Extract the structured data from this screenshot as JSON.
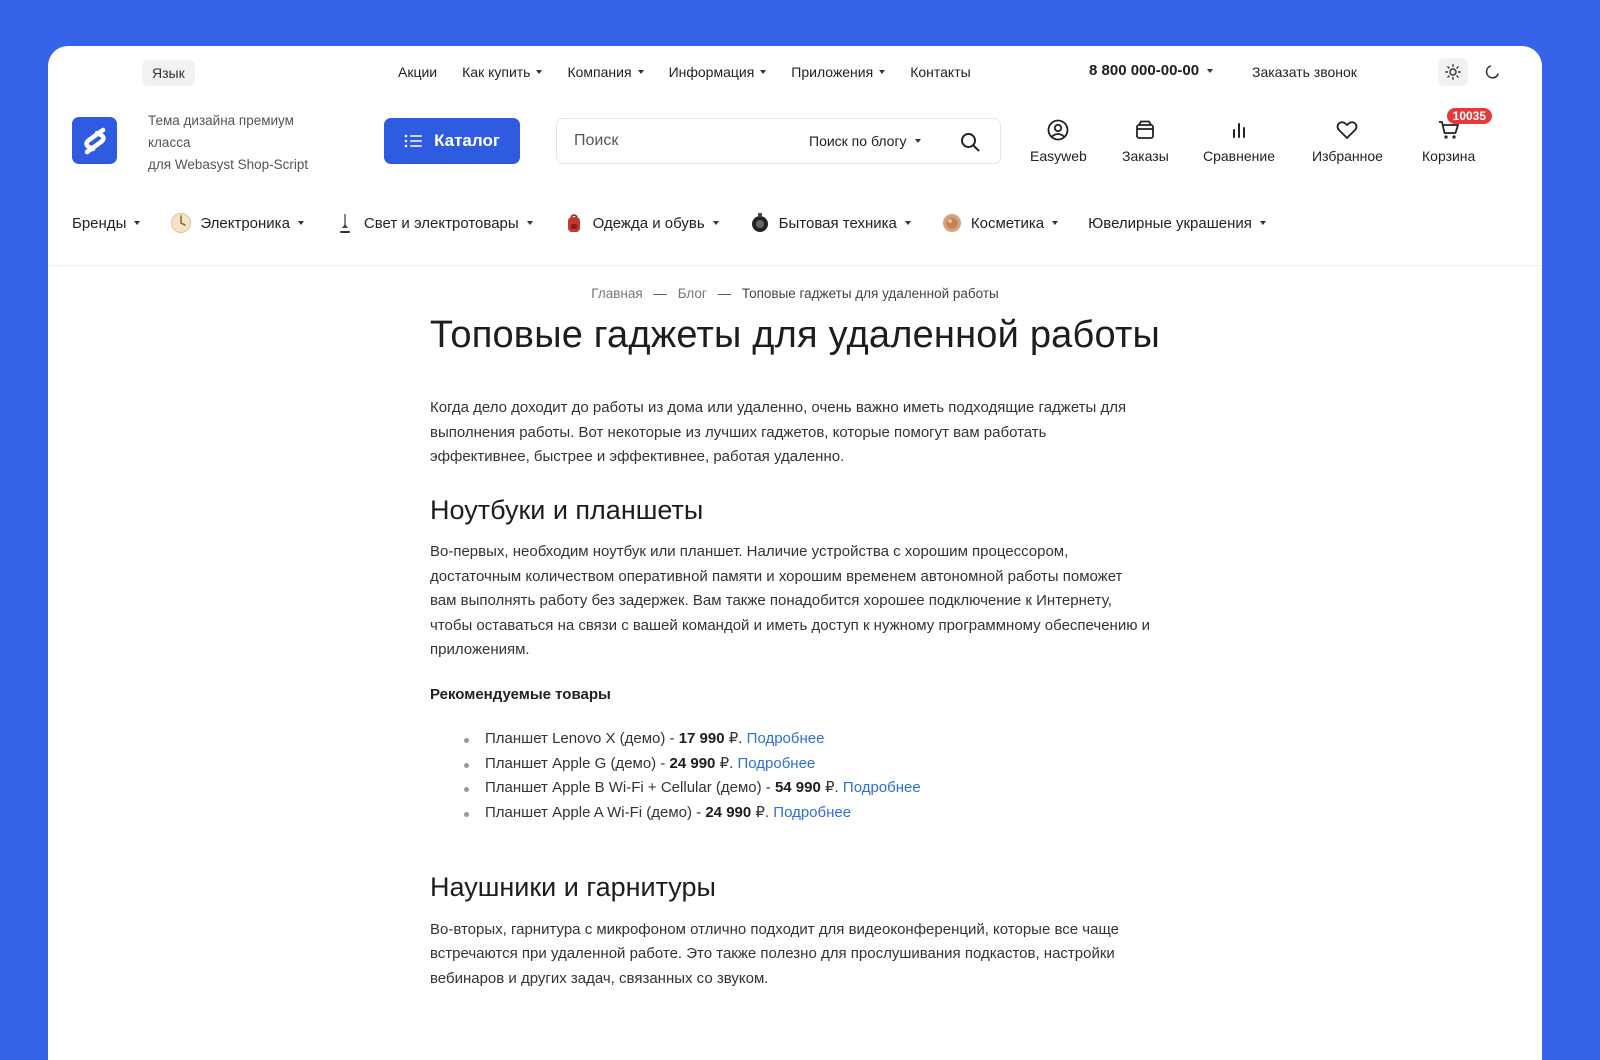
{
  "topbar": {
    "language": "Язык",
    "nav": [
      {
        "label": "Акции",
        "dropdown": false
      },
      {
        "label": "Как купить",
        "dropdown": true
      },
      {
        "label": "Компания",
        "dropdown": true
      },
      {
        "label": "Информация",
        "dropdown": true
      },
      {
        "label": "Приложения",
        "dropdown": true
      },
      {
        "label": "Контакты",
        "dropdown": false
      }
    ],
    "phone": "8 800 000-00-00",
    "callback": "Заказать звонок"
  },
  "header": {
    "tagline_line1": "Тема дизайна премиум",
    "tagline_line2": "класса",
    "tagline_line3": "для Webasyst Shop-Script",
    "catalog_label": "Каталог",
    "search_placeholder": "Поиск",
    "search_scope": "Поиск по блогу",
    "icons": {
      "account": "Easyweb",
      "orders": "Заказы",
      "compare": "Сравнение",
      "favorites": "Избранное",
      "cart": "Корзина",
      "cart_badge": "10035"
    }
  },
  "categories": [
    {
      "label": "Бренды",
      "icon": "none"
    },
    {
      "label": "Электроника",
      "icon": "electronics-icon"
    },
    {
      "label": "Свет и электротовары",
      "icon": "lamp-icon"
    },
    {
      "label": "Одежда и обувь",
      "icon": "backpack-icon"
    },
    {
      "label": "Бытовая техника",
      "icon": "appliance-icon"
    },
    {
      "label": "Косметика",
      "icon": "cosmetics-icon"
    },
    {
      "label": "Ювелирные украшения",
      "icon": "none"
    }
  ],
  "breadcrumb": {
    "home": "Главная",
    "blog": "Блог",
    "current": "Топовые гаджеты для удаленной работы"
  },
  "article": {
    "title": "Топовые гаджеты для удаленной работы",
    "intro": "Когда дело доходит до работы из дома или удаленно, очень важно иметь подходящие гаджеты для выполнения работы. Вот некоторые из лучших гаджетов, которые помогут вам работать эффективнее, быстрее и эффективнее, работая удаленно.",
    "section1_title": "Ноутбуки и планшеты",
    "section1_text": "Во-первых, необходим ноутбук или планшет. Наличие устройства с хорошим процессором, достаточным количеством оперативной памяти и хорошим временем автономной работы поможет вам выполнять работу без задержек. Вам также понадобится хорошее подключение к Интернету, чтобы оставаться на связи с вашей командой и иметь доступ к нужному программному обеспечению и приложениям.",
    "recommended_title": "Рекомендуемые товары",
    "products": [
      {
        "name": "Планшет Lenovo X (демо) - ",
        "price": "17 990",
        "currency": " ₽.",
        "link": "Подробнее"
      },
      {
        "name": "Планшет Apple G (демо) - ",
        "price": "24 990",
        "currency": " ₽.",
        "link": "Подробнее"
      },
      {
        "name": "Планшет Apple B Wi-Fi + Cellular (демо) - ",
        "price": "54 990",
        "currency": " ₽.",
        "link": "Подробнее"
      },
      {
        "name": "Планшет Apple A Wi-Fi (демо) - ",
        "price": "24 990",
        "currency": " ₽.",
        "link": "Подробнее"
      }
    ],
    "section2_title": "Наушники и гарнитуры",
    "section2_text": "Во-вторых, гарнитура с микрофоном отлично подходит для видеоконференций, которые все чаще встречаются при удаленной работе. Это также полезно для прослушивания подкастов, настройки вебинаров и других задач, связанных со звуком."
  },
  "colors": {
    "accent": "#2f5be0",
    "background": "#3563e9",
    "link": "#2f6fd6",
    "badge": "#e53a3a"
  }
}
